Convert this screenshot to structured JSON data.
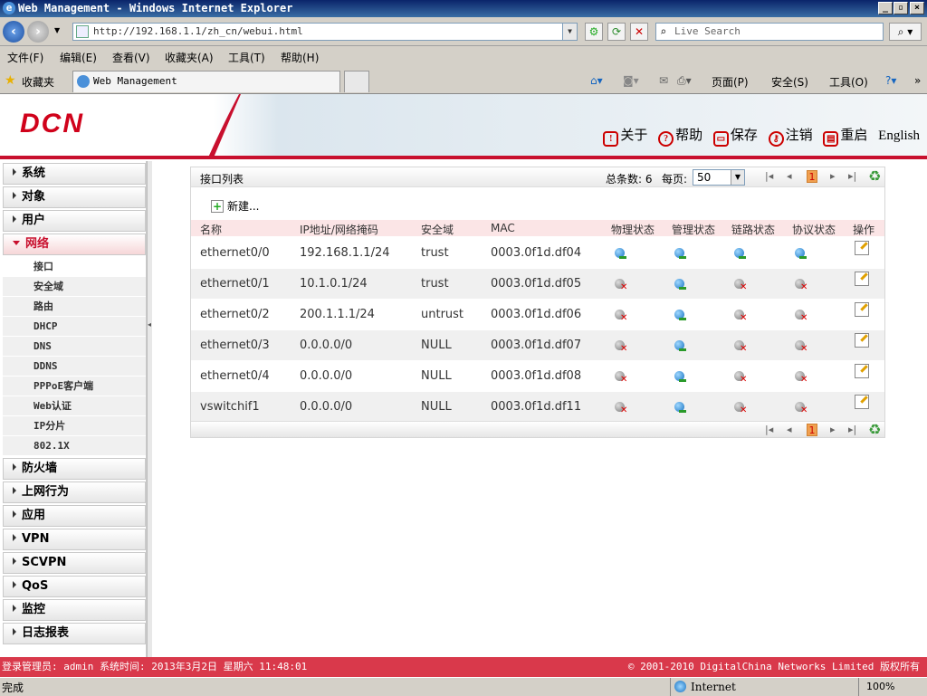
{
  "window": {
    "title": "Web Management - Windows Internet Explorer"
  },
  "browser": {
    "url": "http://192.168.1.1/zh_cn/webui.html",
    "search_placeholder": "Live Search",
    "menu": [
      "文件(F)",
      "编辑(E)",
      "查看(V)",
      "收藏夹(A)",
      "工具(T)",
      "帮助(H)"
    ],
    "favorites_label": "收藏夹",
    "tab_title": "Web Management",
    "command": {
      "page": "页面(P)",
      "safety": "安全(S)",
      "tools": "工具(O)"
    },
    "status": {
      "done": "完成",
      "zone": "Internet",
      "zoom": "100%"
    }
  },
  "header": {
    "logo": "DCN",
    "links": {
      "about": "关于",
      "help": "帮助",
      "save": "保存",
      "logout": "注销",
      "reboot": "重启",
      "english": "English"
    }
  },
  "sidebar": {
    "top_items": [
      {
        "label": "系统"
      },
      {
        "label": "对象"
      },
      {
        "label": "用户"
      }
    ],
    "open_item": {
      "label": "网络"
    },
    "subitems": [
      {
        "label": "接口"
      },
      {
        "label": "安全域"
      },
      {
        "label": "路由"
      },
      {
        "label": "DHCP"
      },
      {
        "label": "DNS"
      },
      {
        "label": "DDNS"
      },
      {
        "label": "PPPoE客户端"
      },
      {
        "label": "Web认证"
      },
      {
        "label": "IP分片"
      },
      {
        "label": "802.1X"
      }
    ],
    "bottom_items": [
      {
        "label": "防火墙"
      },
      {
        "label": "上网行为"
      },
      {
        "label": "应用"
      },
      {
        "label": "VPN"
      },
      {
        "label": "SCVPN"
      },
      {
        "label": "QoS"
      },
      {
        "label": "监控"
      },
      {
        "label": "日志报表"
      }
    ]
  },
  "panel": {
    "title": "接口列表",
    "total_text": "总条数: 6",
    "per_page_label": "每页:",
    "per_page_value": "50",
    "current_page": "1",
    "new_label": "新建...",
    "columns": {
      "name": "名称",
      "ip": "IP地址/网络掩码",
      "zone": "安全域",
      "mac": "MAC",
      "phys": "物理状态",
      "admin": "管理状态",
      "link": "链路状态",
      "proto": "协议状态",
      "action": "操作"
    },
    "rows": [
      {
        "name": "ethernet0/0",
        "ip": "192.168.1.1/24",
        "zone": "trust",
        "mac": "0003.0f1d.df04",
        "phys": "up",
        "admin": "up",
        "link": "up",
        "proto": "up"
      },
      {
        "name": "ethernet0/1",
        "ip": "10.1.0.1/24",
        "zone": "trust",
        "mac": "0003.0f1d.df05",
        "phys": "down",
        "admin": "up",
        "link": "down",
        "proto": "down"
      },
      {
        "name": "ethernet0/2",
        "ip": "200.1.1.1/24",
        "zone": "untrust",
        "mac": "0003.0f1d.df06",
        "phys": "down",
        "admin": "up",
        "link": "down",
        "proto": "down"
      },
      {
        "name": "ethernet0/3",
        "ip": "0.0.0.0/0",
        "zone": "NULL",
        "mac": "0003.0f1d.df07",
        "phys": "down",
        "admin": "up",
        "link": "down",
        "proto": "down"
      },
      {
        "name": "ethernet0/4",
        "ip": "0.0.0.0/0",
        "zone": "NULL",
        "mac": "0003.0f1d.df08",
        "phys": "down",
        "admin": "up",
        "link": "down",
        "proto": "down"
      },
      {
        "name": "vswitchif1",
        "ip": "0.0.0.0/0",
        "zone": "NULL",
        "mac": "0003.0f1d.df11",
        "phys": "down",
        "admin": "up",
        "link": "down",
        "proto": "down"
      }
    ]
  },
  "footer": {
    "left": "登录管理员: admin 系统时间: 2013年3月2日 星期六 11:48:01",
    "right": "© 2001-2010 DigitalChina Networks Limited 版权所有"
  },
  "colors": {
    "accent": "#c8102e",
    "footer": "#d9394b",
    "table_header": "#fbe5e6"
  }
}
